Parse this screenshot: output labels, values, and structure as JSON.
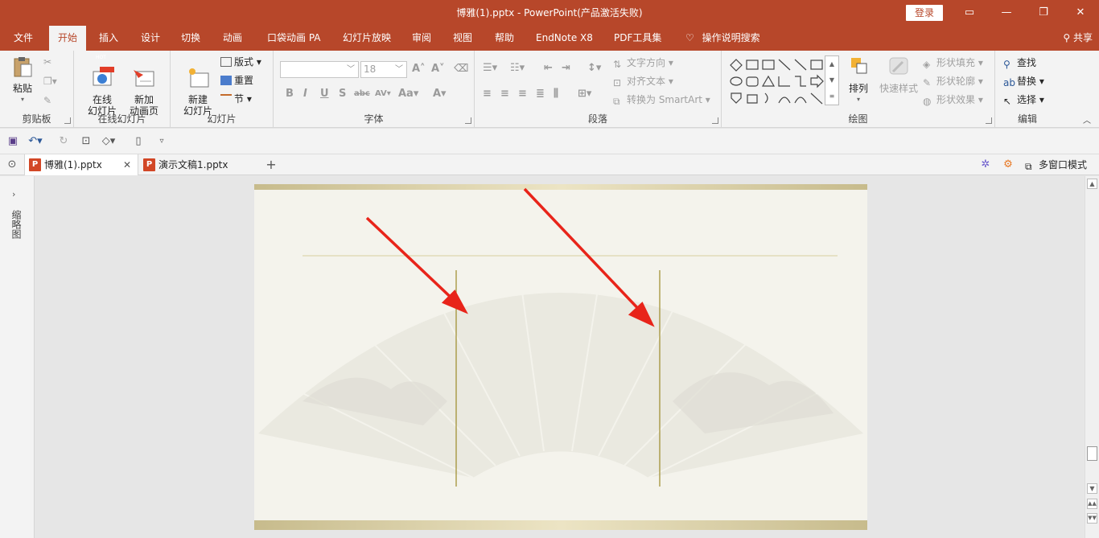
{
  "window": {
    "title": "博雅(1).pptx  -  PowerPoint(产品激活失败)",
    "login_label": "登录",
    "controls": [
      "restore-ribbon",
      "minimize",
      "maximize",
      "close"
    ]
  },
  "tabs": [
    {
      "label": "文件",
      "active": false
    },
    {
      "label": "开始",
      "active": true
    },
    {
      "label": "插入",
      "active": false
    },
    {
      "label": "设计",
      "active": false
    },
    {
      "label": "切换",
      "active": false
    },
    {
      "label": "动画",
      "active": false
    },
    {
      "label": "口袋动画 PA",
      "active": false
    },
    {
      "label": "幻灯片放映",
      "active": false
    },
    {
      "label": "审阅",
      "active": false
    },
    {
      "label": "视图",
      "active": false
    },
    {
      "label": "帮助",
      "active": false
    },
    {
      "label": "EndNote X8",
      "active": false
    },
    {
      "label": "PDF工具集",
      "active": false
    },
    {
      "label": "操作说明搜索",
      "active": false
    }
  ],
  "share_label": "共享",
  "ribbon": {
    "clipboard": {
      "label": "剪贴板",
      "paste": "粘贴"
    },
    "online_slides": {
      "label": "在线幻灯片",
      "online_slide": "在线\n幻灯片",
      "new_anim_page": "新加\n动画页",
      "hot_badge": "HOT"
    },
    "slides": {
      "label": "幻灯片",
      "new_slide": "新建\n幻灯片",
      "layout": "版式",
      "reset": "重置",
      "section": "节"
    },
    "font": {
      "label": "字体",
      "font_size": "18",
      "font_name": ""
    },
    "paragraph": {
      "label": "段落",
      "text_direction": "文字方向",
      "align_text": "对齐文本",
      "convert_smartart": "转换为 SmartArt"
    },
    "drawing": {
      "label": "绘图",
      "arrange": "排列",
      "quick_styles": "快速样式",
      "shape_fill": "形状填充",
      "shape_outline": "形状轮廓",
      "shape_effects": "形状效果"
    },
    "editing": {
      "label": "编辑",
      "find": "查找",
      "replace": "替换",
      "select": "选择"
    }
  },
  "doc_tabs": [
    {
      "label": "博雅(1).pptx",
      "active": true
    },
    {
      "label": "演示文稿1.pptx",
      "active": false
    }
  ],
  "multi_window_label": "多窗口模式",
  "left_panel_label": "缩略图",
  "colors": {
    "accent": "#b7472a",
    "slide_bg": "#f4f3ec",
    "gold": "#c7bb8c",
    "arrow": "#e8241a"
  }
}
